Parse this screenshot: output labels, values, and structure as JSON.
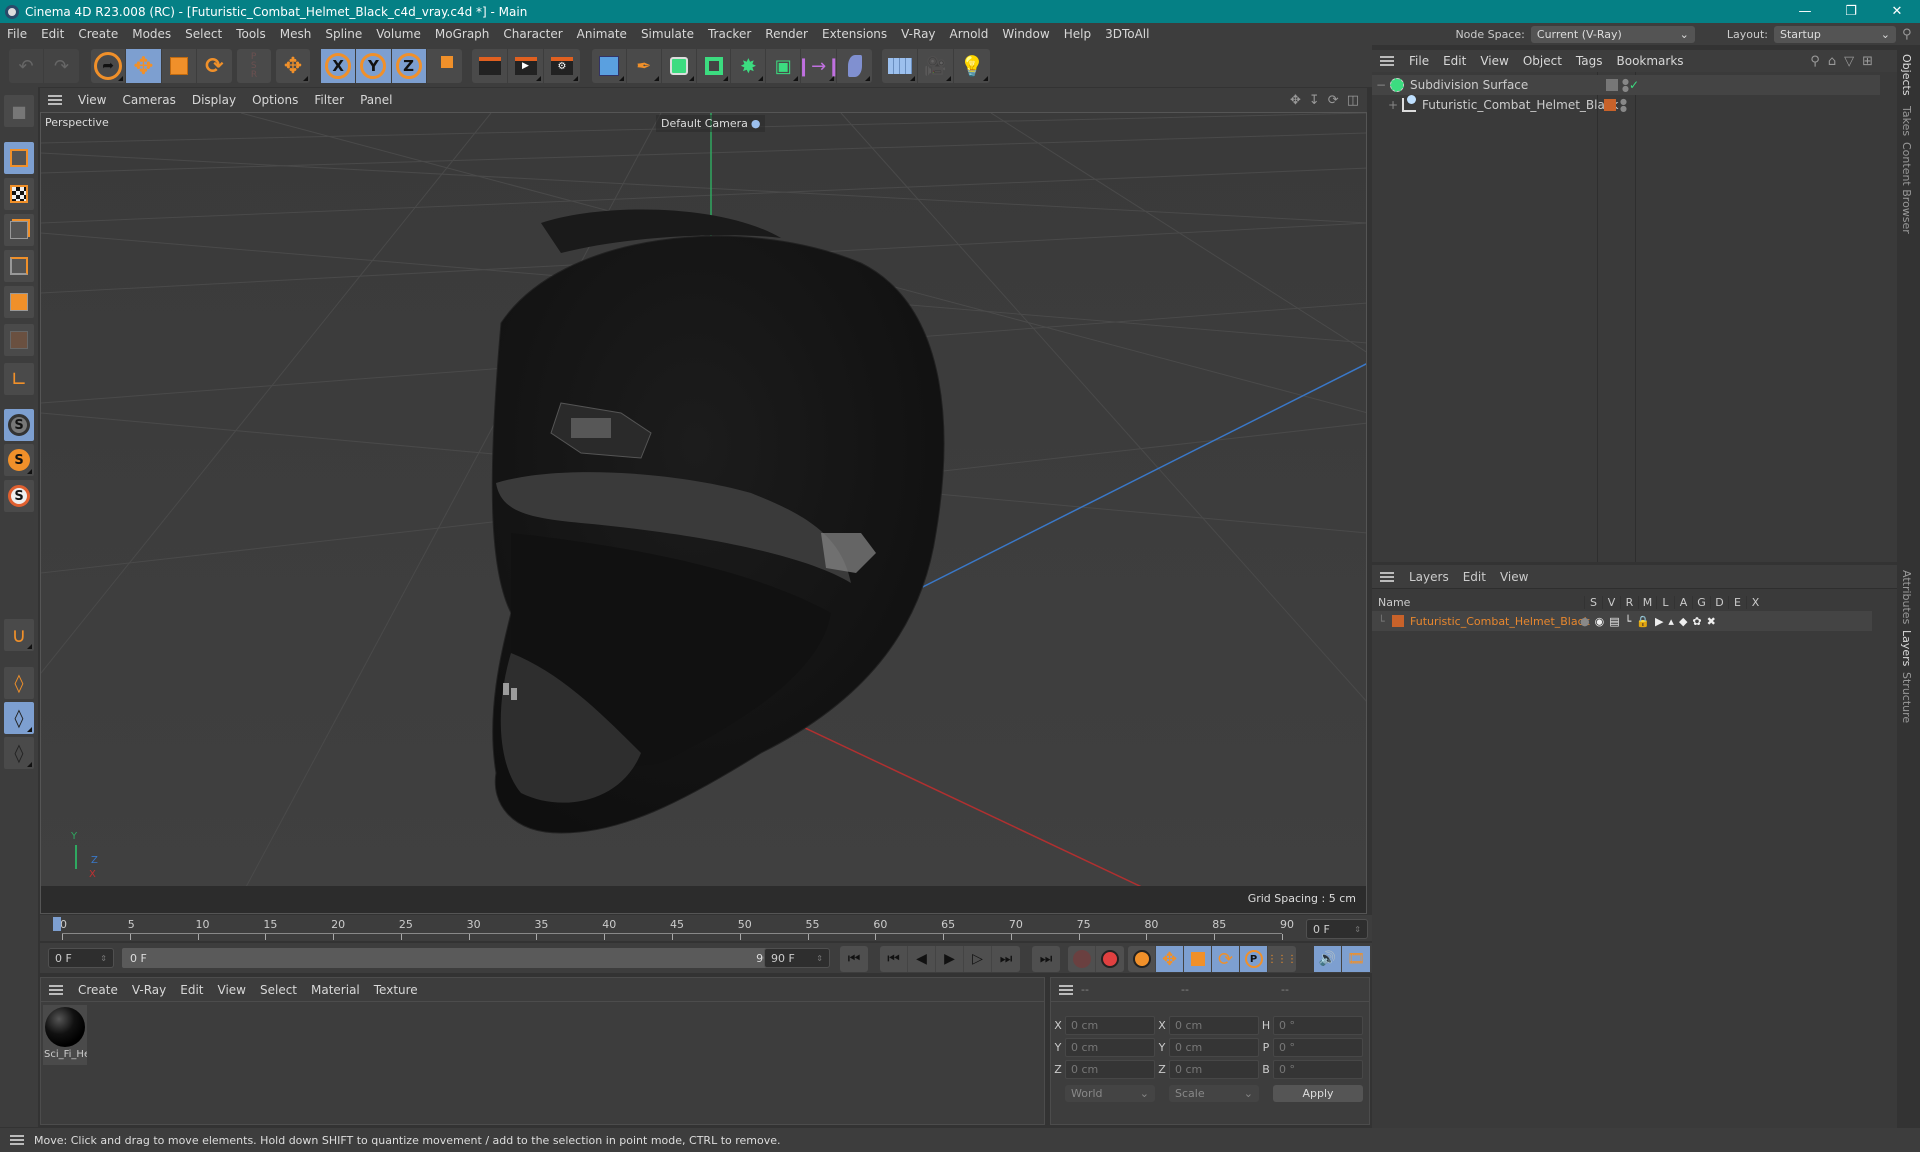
{
  "window": {
    "title": "Cinema 4D R23.008 (RC) - [Futuristic_Combat_Helmet_Black_c4d_vray.c4d *] - Main",
    "controls": [
      "minimize",
      "restore",
      "close"
    ]
  },
  "menubar": {
    "items": [
      "File",
      "Edit",
      "Create",
      "Modes",
      "Select",
      "Tools",
      "Mesh",
      "Spline",
      "Volume",
      "MoGraph",
      "Character",
      "Animate",
      "Simulate",
      "Tracker",
      "Render",
      "Extensions",
      "V-Ray",
      "Arnold",
      "Window",
      "Help",
      "3DToAll"
    ],
    "node_space_label": "Node Space:",
    "node_space_value": "Current (V-Ray)",
    "layout_label": "Layout:",
    "layout_value": "Startup"
  },
  "toolbar": {
    "groups": [
      {
        "name": "history",
        "icons": [
          "undo-icon",
          "redo-icon"
        ]
      },
      {
        "name": "tools",
        "icons": [
          "select-icon",
          "move-icon",
          "scale-icon",
          "rotate-icon"
        ],
        "active": "move-icon"
      },
      {
        "name": "psr",
        "icons": [
          "psr-reset-icon"
        ]
      },
      {
        "name": "add",
        "icons": [
          "add-move-icon"
        ]
      },
      {
        "name": "axis",
        "icons": [
          "x-axis-lock-icon",
          "y-axis-lock-icon",
          "z-axis-lock-icon",
          "coordinate-system-icon"
        ],
        "labels": [
          "X",
          "Y",
          "Z"
        ]
      },
      {
        "name": "render",
        "icons": [
          "render-view-icon",
          "render-picture-viewer-icon",
          "render-settings-icon"
        ]
      },
      {
        "name": "create",
        "icons": [
          "cube-icon",
          "pen-icon",
          "subdivision-icon",
          "extrude-icon",
          "cloner-icon",
          "mograph-array-icon",
          "symmetry-icon",
          "deformer-icon",
          "floor-icon",
          "camera-icon",
          "light-icon"
        ]
      }
    ]
  },
  "left_tools": [
    "model-mode-icon",
    "object-mode-icon",
    "texture-mode-icon",
    "points-mode-icon",
    "edges-mode-icon",
    "polygons-mode-icon",
    "uvw-mode-icon",
    "axis-mode-icon",
    "solo-off-icon",
    "solo-single-icon",
    "solo-hierarchy-icon",
    "snap-icon",
    "workplane-icon",
    "locked-workplane-icon",
    "workplane-rotate-icon"
  ],
  "viewport": {
    "menu": [
      "View",
      "Cameras",
      "Display",
      "Options",
      "Filter",
      "Panel"
    ],
    "view_label": "Perspective",
    "camera_label": "Default Camera",
    "grid_spacing": "Grid Spacing : 5 cm",
    "axis": {
      "x": "X",
      "y": "Y",
      "z": "Z"
    }
  },
  "timeline": {
    "ticks": [
      "0",
      "5",
      "10",
      "15",
      "20",
      "25",
      "30",
      "35",
      "40",
      "45",
      "50",
      "55",
      "60",
      "65",
      "70",
      "75",
      "80",
      "85",
      "90"
    ],
    "current_frame_right": "0 F",
    "start_field": "0 F",
    "range_start": "0 F",
    "range_end": "90 F",
    "end_field": "90 F"
  },
  "transport": {
    "buttons": [
      "go-to-start-icon",
      "previous-key-icon",
      "previous-frame-icon",
      "play-icon",
      "next-frame-icon",
      "next-key-icon",
      "go-to-end-icon",
      "record-disabled-icon",
      "autokey-icon",
      "keyframe-selection-icon",
      "key-position-icon",
      "key-scale-icon",
      "key-rotation-icon",
      "key-parameter-icon",
      "key-pla-icon",
      "sound-icon",
      "timeline-icon"
    ]
  },
  "material_panel": {
    "menu": [
      "Create",
      "V-Ray",
      "Edit",
      "View",
      "Select",
      "Material",
      "Texture"
    ],
    "materials": [
      {
        "name": "Sci_Fi_He"
      }
    ]
  },
  "coordinates": {
    "headers": [
      "--",
      "--",
      "--"
    ],
    "rows": [
      {
        "pos_label": "X",
        "pos": "0 cm",
        "size_label": "X",
        "size": "0 cm",
        "rot_label": "H",
        "rot": "0 °"
      },
      {
        "pos_label": "Y",
        "pos": "0 cm",
        "size_label": "Y",
        "size": "0 cm",
        "rot_label": "P",
        "rot": "0 °"
      },
      {
        "pos_label": "Z",
        "pos": "0 cm",
        "size_label": "Z",
        "size": "0 cm",
        "rot_label": "B",
        "rot": "0 °"
      }
    ],
    "mode_value": "World",
    "scale_value": "Scale",
    "apply_label": "Apply"
  },
  "objects_panel": {
    "menu": [
      "File",
      "Edit",
      "View",
      "Object",
      "Tags",
      "Bookmarks"
    ],
    "items": [
      {
        "name": "Subdivision Surface",
        "expand": "−",
        "icon": "subdivision-surface-icon"
      },
      {
        "name": "Futuristic_Combat_Helmet_Black",
        "expand": "+",
        "icon": "polygon-object-icon",
        "layer_color": "#c8622a"
      }
    ]
  },
  "layers_panel": {
    "menu": [
      "Layers",
      "Edit",
      "View"
    ],
    "columns": [
      "Name",
      "S",
      "V",
      "R",
      "M",
      "L",
      "A",
      "G",
      "D",
      "E",
      "X"
    ],
    "rows": [
      {
        "name": "Futuristic_Combat_Helmet_Black",
        "color": "#c8622a"
      }
    ]
  },
  "side_tabs": {
    "top": [
      "Objects",
      "Takes",
      "Content Browser"
    ],
    "bottom": [
      "Attributes",
      "Layers",
      "Structure"
    ]
  },
  "status_bar": {
    "text": "Move: Click and drag to move elements. Hold down SHIFT to quantize movement / add to the selection in point mode, CTRL to remove."
  },
  "colors": {
    "titlebar": "#058085",
    "accent_orange": "#f0902a",
    "active_blue": "#7d9fd0",
    "layer_orange": "#c8622a",
    "layer_text": "#e8872e"
  }
}
